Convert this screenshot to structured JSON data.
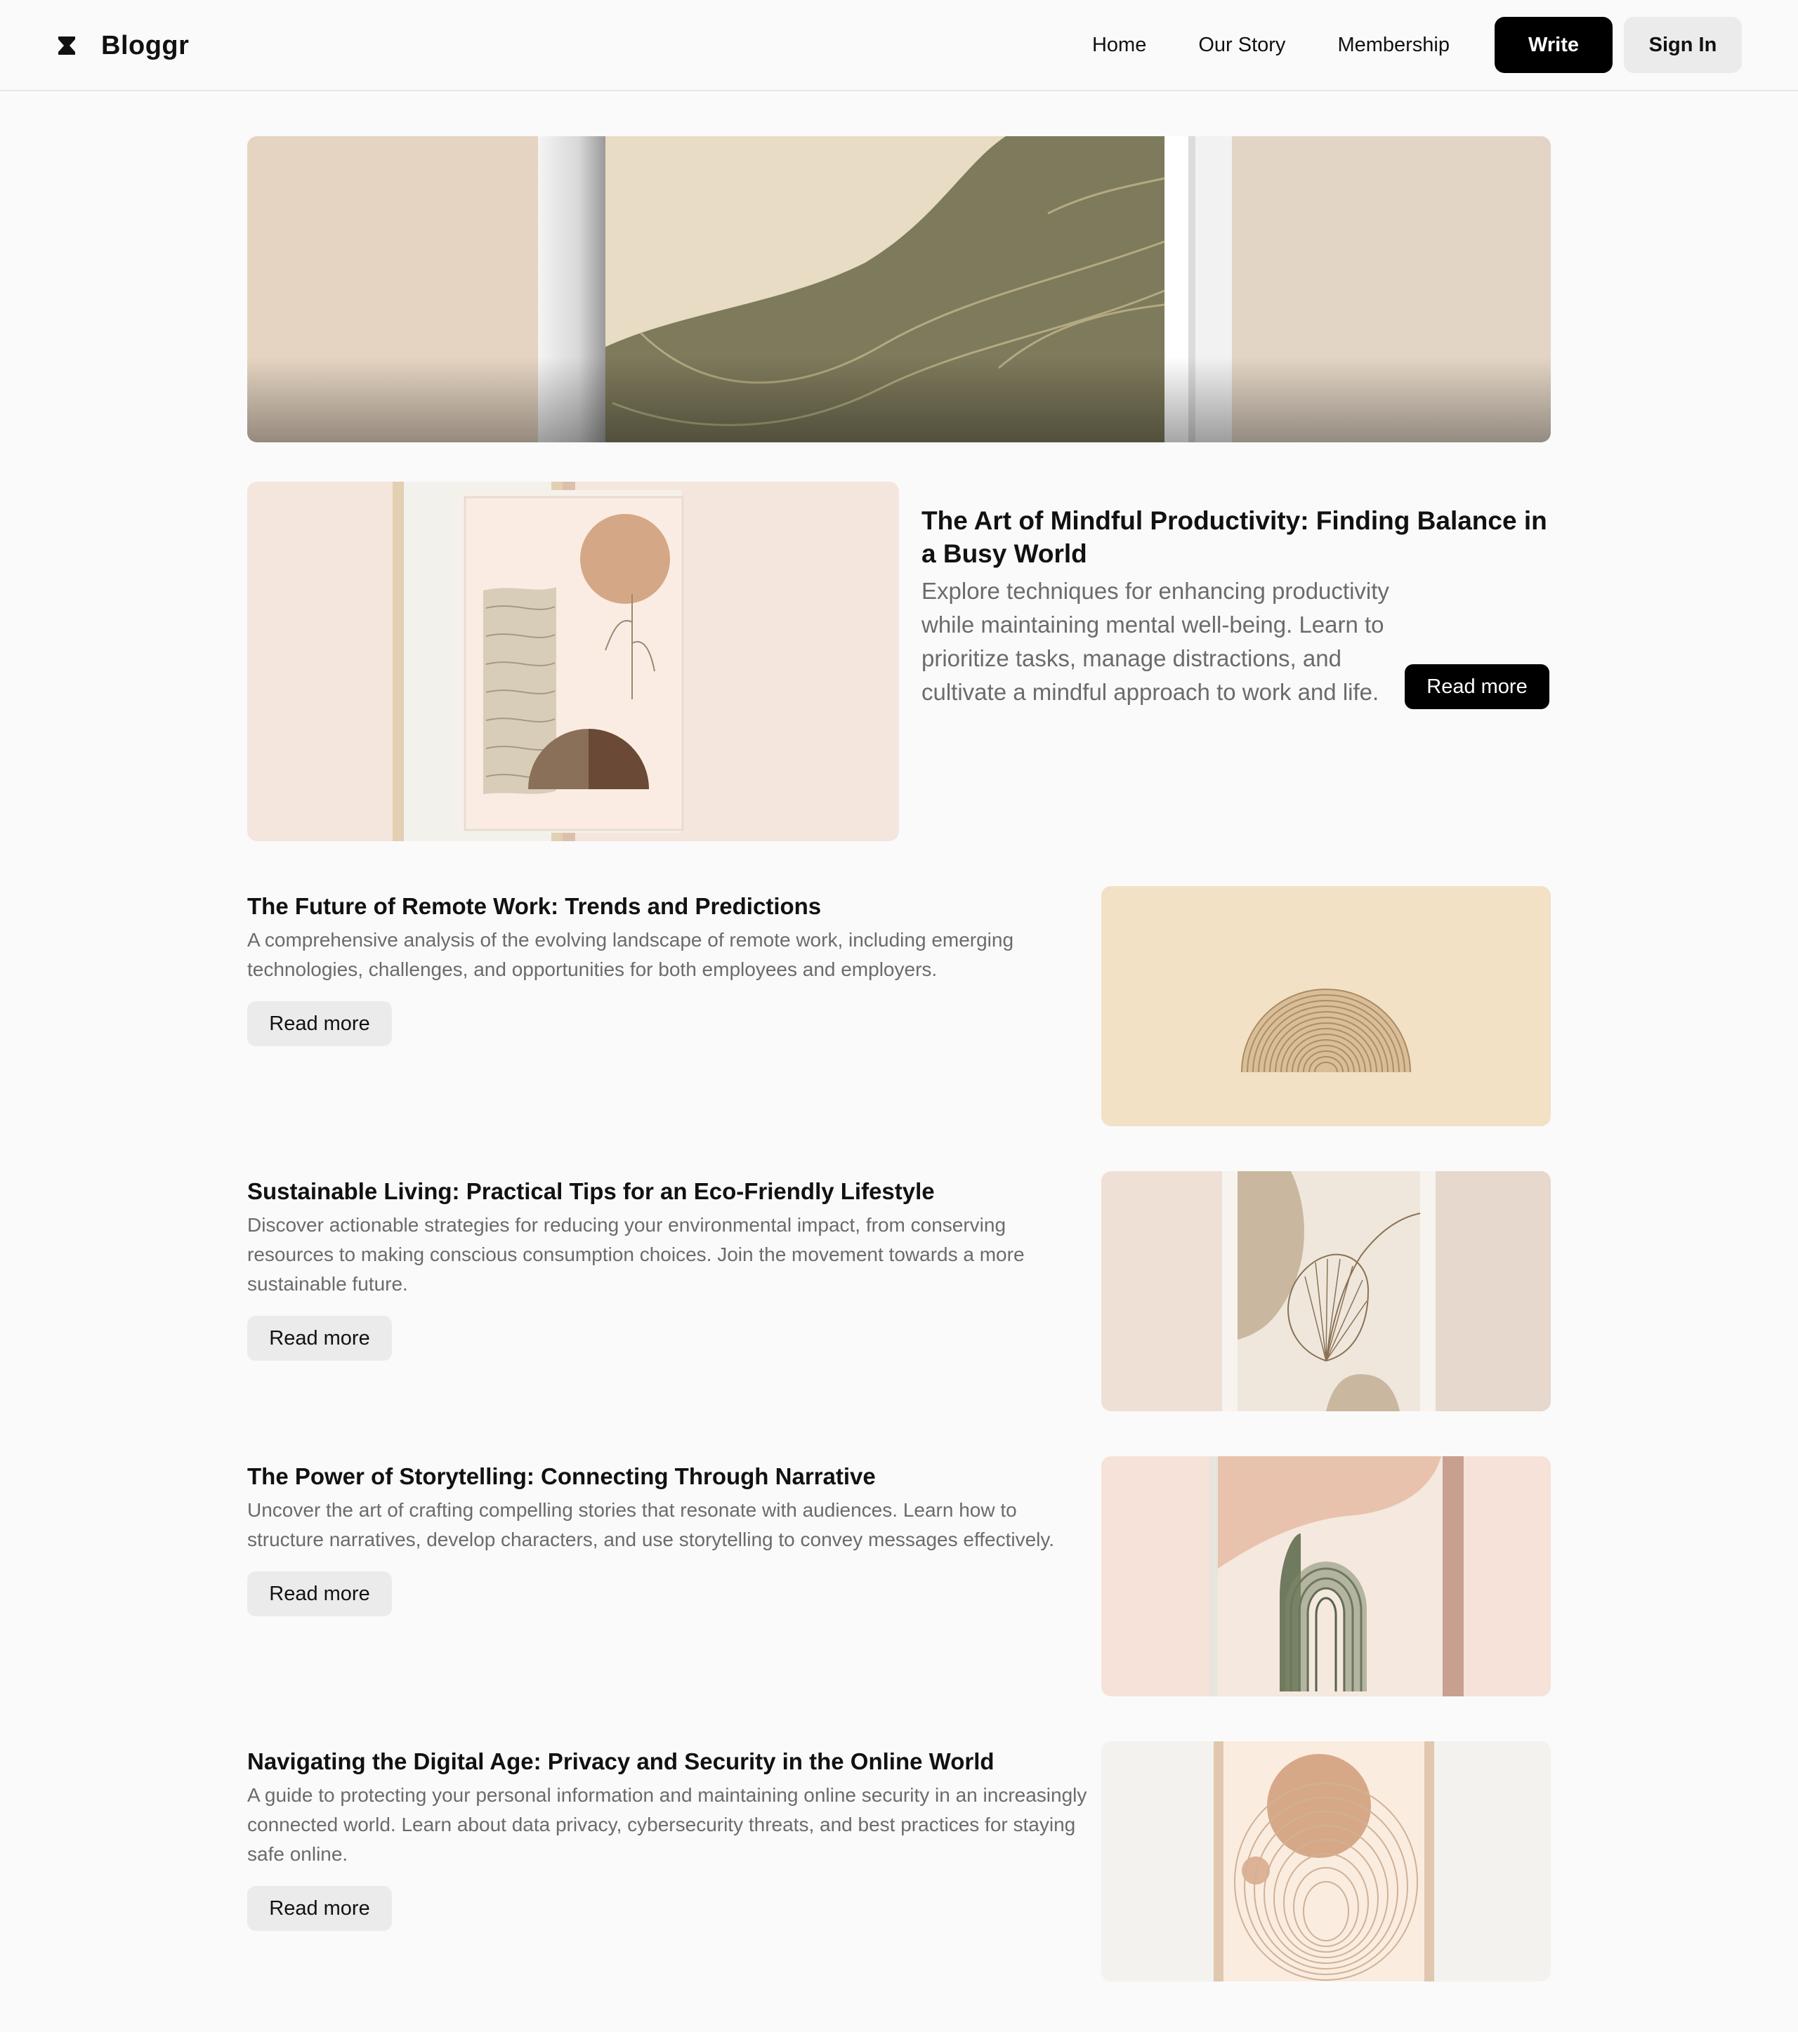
{
  "header": {
    "brand": "Bloggr",
    "nav": [
      "Home",
      "Our Story",
      "Membership"
    ],
    "write_label": "Write",
    "signin_label": "Sign In"
  },
  "featured": {
    "title": "The Art of Mindful Productivity: Finding Balance in a Busy World",
    "description": "Explore techniques for enhancing productivity while maintaining mental well-being. Learn to prioritize tasks, manage distractions, and cultivate a mindful approach to work and life.",
    "button": "Read more"
  },
  "articles": [
    {
      "title": "The Future of Remote Work: Trends and Predictions",
      "description": "A comprehensive analysis of the evolving landscape of remote work, including emerging technologies, challenges, and opportunities for both employees and employers.",
      "button": "Read more"
    },
    {
      "title": "Sustainable Living: Practical Tips for an Eco-Friendly Lifestyle",
      "description": "Discover actionable strategies for reducing your environmental impact, from conserving resources to making conscious consumption choices. Join the movement towards a more sustainable future.",
      "button": "Read more"
    },
    {
      "title": "The Power of Storytelling: Connecting Through Narrative",
      "description": "Uncover the art of crafting compelling stories that resonate with audiences. Learn how to structure narratives, develop characters, and use storytelling to convey messages effectively.",
      "button": "Read more"
    },
    {
      "title": "Navigating the Digital Age: Privacy and Security in the Online World",
      "description": "A guide to protecting your personal information and maintaining online security in an increasingly connected world. Learn about data privacy, cybersecurity threats, and best practices for staying safe online.",
      "button": "Read more"
    }
  ]
}
